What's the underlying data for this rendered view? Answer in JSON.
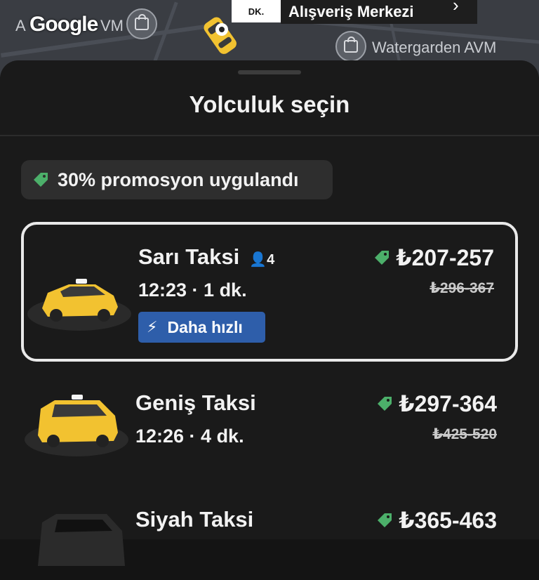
{
  "map": {
    "labels": {
      "avm_left_prefix": "A",
      "avm_left_suffix": "VM",
      "watergarden": "Watergarden AVM"
    },
    "google_logo": "Google",
    "eta_box": "DK.",
    "destination": "Alışveriş Merkezi",
    "icons": {
      "shop": "shopping-bag-icon",
      "car": "taxi-marker-icon",
      "chevron": "chevron-right-icon"
    }
  },
  "sheet": {
    "title": "Yolculuk seçin"
  },
  "promo": {
    "text": "30% promosyon uygulandı",
    "icon": "tag-icon"
  },
  "rides": [
    {
      "name": "Sarı Taksi",
      "capacity": "4",
      "time": "12:23 · 1 dk.",
      "price": "₺207-257",
      "old_price": "₺296-367",
      "badge": "Daha hızlı",
      "selected": true
    },
    {
      "name": "Geniş Taksi",
      "time": "12:26 · 4 dk.",
      "price": "₺297-364",
      "old_price": "₺425-520"
    },
    {
      "name": "Siyah Taksi",
      "price": "₺365-463"
    }
  ],
  "colors": {
    "background": "#141414",
    "sheet": "#1a1a1a",
    "promo_green": "#4caf6a",
    "badge_blue": "#2e5eaa",
    "taxi_yellow": "#f2c230"
  }
}
